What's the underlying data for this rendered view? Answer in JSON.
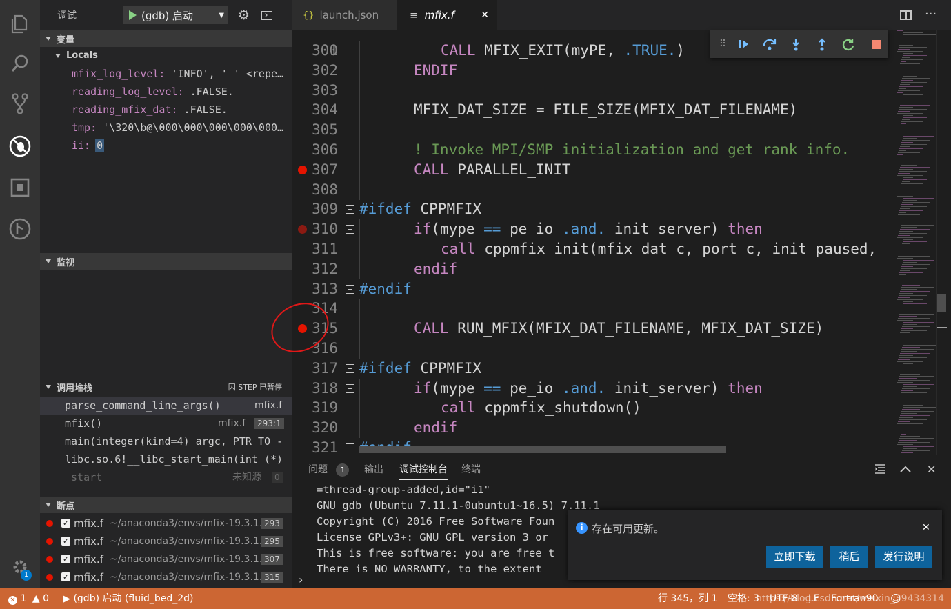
{
  "sidebar": {
    "title": "调试",
    "config_name": "(gdb) 启动",
    "variables_header": "变量",
    "locals_header": "Locals",
    "variables": [
      {
        "name": "mfix_log_level:",
        "value": " 'INFO', ' ' <repe…"
      },
      {
        "name": "reading_log_level:",
        "value": " .FALSE."
      },
      {
        "name": "reading_mfix_dat:",
        "value": " .FALSE."
      },
      {
        "name": "tmp:",
        "value": " '\\320\\b@\\000\\000\\000\\000\\000…"
      },
      {
        "name": "ii:",
        "value": "0"
      }
    ],
    "watch_header": "监视",
    "callstack_header": "调用堆栈",
    "callstack_status": "因 STEP 已暂停",
    "callstack": [
      {
        "fn": "parse_command_line_args()",
        "file": "mfix.f",
        "line": ""
      },
      {
        "fn": "mfix()",
        "file": "mfix.f",
        "line": "293:1"
      },
      {
        "fn": "main(integer(kind=4) argc, PTR TO -",
        "file": "",
        "line": ""
      },
      {
        "fn": "libc.so.6!__libc_start_main(int (*)",
        "file": "",
        "line": ""
      },
      {
        "fn": "_start",
        "file": "未知源",
        "line": "0"
      }
    ],
    "breakpoints_header": "断点",
    "breakpoints": [
      {
        "name": "mfix.f",
        "path": "~/anaconda3/envs/mfix-19.3.1…",
        "line": "293"
      },
      {
        "name": "mfix.f",
        "path": "~/anaconda3/envs/mfix-19.3.1…",
        "line": "295"
      },
      {
        "name": "mfix.f",
        "path": "~/anaconda3/envs/mfix-19.3.1…",
        "line": "307"
      },
      {
        "name": "mfix.f",
        "path": "~/anaconda3/envs/mfix-19.3.1…",
        "line": "315"
      }
    ]
  },
  "tabs": [
    {
      "icon": "{}",
      "label": "launch.json"
    },
    {
      "icon": "≡",
      "label": "mfix.f"
    }
  ],
  "editor": {
    "top_partial": "300",
    "lines": [
      {
        "n": "301",
        "tokens": [
          [
            "kw",
            "CALL "
          ],
          [
            "id",
            "MFIX_EXIT(myPE, "
          ],
          [
            "kw2",
            ".TRUE."
          ],
          [
            "id",
            ")"
          ]
        ],
        "indent": 2
      },
      {
        "n": "302",
        "tokens": [
          [
            "kw",
            "ENDIF"
          ]
        ],
        "indent": 1
      },
      {
        "n": "303",
        "tokens": [],
        "indent": 1
      },
      {
        "n": "304",
        "tokens": [
          [
            "id",
            "MFIX_DAT_SIZE = FILE_SIZE(MFIX_DAT_FILENAME)"
          ]
        ],
        "indent": 1
      },
      {
        "n": "305",
        "tokens": [],
        "indent": 1
      },
      {
        "n": "306",
        "tokens": [
          [
            "cm",
            "! Invoke MPI/SMP initialization and get rank info."
          ]
        ],
        "indent": 1
      },
      {
        "n": "307",
        "tokens": [
          [
            "kw",
            "CALL "
          ],
          [
            "id",
            "PARALLEL_INIT"
          ]
        ],
        "indent": 1,
        "bp": "on"
      },
      {
        "n": "308",
        "tokens": [],
        "indent": 1
      },
      {
        "n": "309",
        "tokens": [
          [
            "kw2",
            "#ifdef "
          ],
          [
            "id",
            "CPPMFIX"
          ]
        ],
        "indent": 0,
        "fold": true
      },
      {
        "n": "310",
        "tokens": [
          [
            "kw",
            "if"
          ],
          [
            "id",
            "(mype "
          ],
          [
            "kw2",
            "=="
          ],
          [
            "id",
            " pe_io "
          ],
          [
            "kw2",
            ".and."
          ],
          [
            "id",
            " init_server) "
          ],
          [
            "kw",
            "then"
          ]
        ],
        "indent": 1,
        "bp": "dim",
        "fold": true
      },
      {
        "n": "311",
        "tokens": [
          [
            "kw",
            "call "
          ],
          [
            "id",
            "cppmfix_init(mfix_dat_c, port_c, init_paused,"
          ]
        ],
        "indent": 2
      },
      {
        "n": "312",
        "tokens": [
          [
            "kw",
            "endif"
          ]
        ],
        "indent": 1
      },
      {
        "n": "313",
        "tokens": [
          [
            "kw2",
            "#endif"
          ]
        ],
        "indent": 0,
        "fold": true
      },
      {
        "n": "314",
        "tokens": [],
        "indent": 1
      },
      {
        "n": "315",
        "tokens": [
          [
            "kw",
            "CALL "
          ],
          [
            "id",
            "RUN_MFIX(MFIX_DAT_FILENAME, MFIX_DAT_SIZE)"
          ]
        ],
        "indent": 1,
        "bp": "on"
      },
      {
        "n": "316",
        "tokens": [],
        "indent": 1
      },
      {
        "n": "317",
        "tokens": [
          [
            "kw2",
            "#ifdef "
          ],
          [
            "id",
            "CPPMFIX"
          ]
        ],
        "indent": 0,
        "fold": true
      },
      {
        "n": "318",
        "tokens": [
          [
            "kw",
            "if"
          ],
          [
            "id",
            "(mype "
          ],
          [
            "kw2",
            "=="
          ],
          [
            "id",
            " pe_io "
          ],
          [
            "kw2",
            ".and."
          ],
          [
            "id",
            " init_server) "
          ],
          [
            "kw",
            "then"
          ]
        ],
        "indent": 1,
        "fold": true
      },
      {
        "n": "319",
        "tokens": [
          [
            "kw",
            "call "
          ],
          [
            "id",
            "cppmfix_shutdown()"
          ]
        ],
        "indent": 2
      },
      {
        "n": "320",
        "tokens": [
          [
            "kw",
            "endif"
          ]
        ],
        "indent": 1
      },
      {
        "n": "321",
        "tokens": [
          [
            "kw2",
            "#endif"
          ]
        ],
        "indent": 0,
        "fold": true
      }
    ]
  },
  "panel": {
    "tabs": [
      "问题",
      "输出",
      "调试控制台",
      "终端"
    ],
    "problem_count": "1",
    "console": [
      "=thread-group-added,id=\"i1\"",
      "GNU gdb (Ubuntu 7.11.1-0ubuntu1~16.5) 7.11.1",
      "Copyright (C) 2016 Free Software Foun",
      "License GPLv3+: GNU GPL version 3 or",
      "This is free software: you are free t",
      "There is NO WARRANTY, to the extent"
    ],
    "prompt": "›"
  },
  "notification": {
    "message": "存在可用更新。",
    "buttons": [
      "立即下载",
      "稍后",
      "发行说明"
    ]
  },
  "status": {
    "errors": "1",
    "warnings": "0",
    "debug_target": "(gdb) 启动 (fluid_bed_2d)",
    "position": "行 345，列 1",
    "spaces": "空格: 3",
    "encoding": "UTF-8",
    "eol": "LF",
    "language": "Fortran90",
    "watermark": "https://blog.csdn.net/weixin_39434314"
  },
  "activity_badge": "1"
}
